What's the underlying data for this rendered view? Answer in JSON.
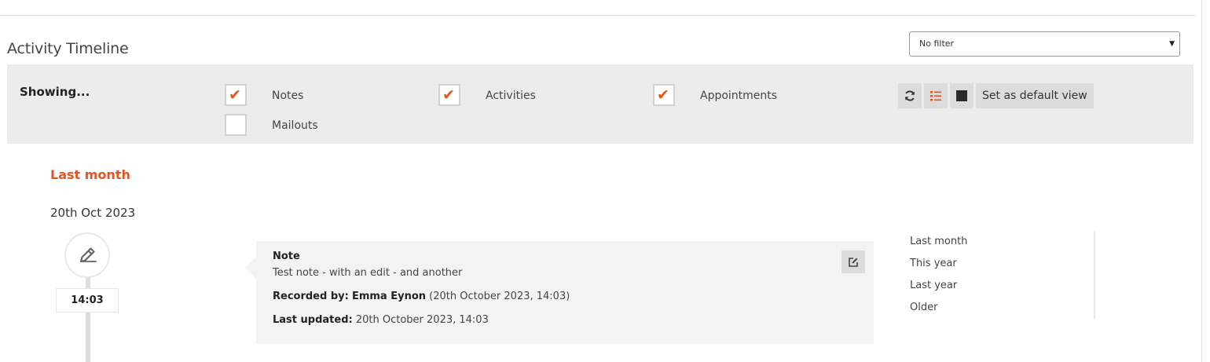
{
  "header": {
    "title": "Activity Timeline"
  },
  "filter": {
    "selected": "No filter"
  },
  "showing": {
    "label": "Showing...",
    "types": [
      {
        "label": "Notes",
        "checked": true
      },
      {
        "label": "Activities",
        "checked": true
      },
      {
        "label": "Appointments",
        "checked": true
      },
      {
        "label": "Mailouts",
        "checked": false
      }
    ],
    "toolbar": {
      "default_label": "Set as default view"
    }
  },
  "timeline": {
    "section": "Last month",
    "date": "20th Oct 2023",
    "entry": {
      "time": "14:03",
      "type": "Note",
      "text": "Test note - with an edit - and another",
      "recorded_by_label": "Recorded by:",
      "recorded_by_name": "Emma Eynon",
      "recorded_when": "(20th October 2023, 14:03)",
      "updated_label": "Last updated:",
      "updated_when": "20th October 2023, 14:03"
    }
  },
  "jump_nav": [
    "Last month",
    "This year",
    "Last year",
    "Older"
  ],
  "colors": {
    "accent": "#e8531f",
    "panel": "#ececec",
    "card": "#f3f3f3"
  }
}
